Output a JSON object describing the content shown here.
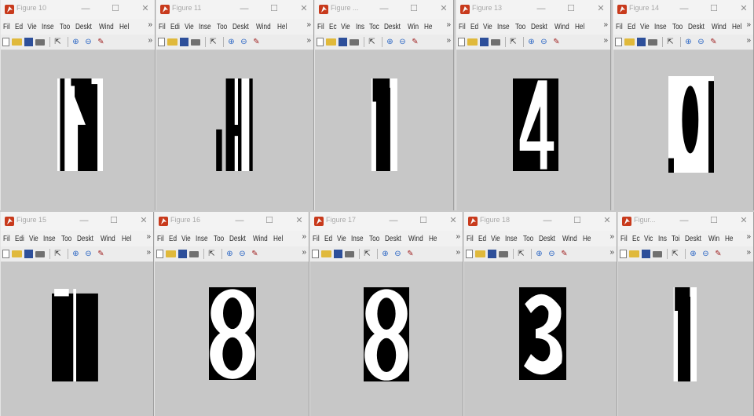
{
  "windows": [
    {
      "title": "Figure 10",
      "menus": [
        "Fil",
        "Ed",
        "Vie",
        "Inse",
        "Too",
        "Deskt",
        "Wind",
        "Hel"
      ],
      "glyph": "M"
    },
    {
      "title": "Figure 11",
      "menus": [
        "Fil",
        "Edi",
        "Vie",
        "Inse",
        "Too",
        "Deskt",
        "Wind",
        "Hel"
      ],
      "glyph": "H"
    },
    {
      "title": "Figure ...",
      "menus": [
        "Fil",
        "Ec",
        "Vie",
        "Ins",
        "Toc",
        "Deskt",
        "Win",
        "He"
      ],
      "glyph": "1"
    },
    {
      "title": "Figure 13",
      "menus": [
        "Fil",
        "Ed",
        "Vie",
        "Inse",
        "Too",
        "Deskt",
        "Wind",
        "Hel"
      ],
      "glyph": "4"
    },
    {
      "title": "Figure 14",
      "menus": [
        "Fil",
        "Ed",
        "Vie",
        "Inse",
        "Too",
        "Deskt",
        "Wind",
        "Hel"
      ],
      "glyph": "0"
    },
    {
      "title": "Figure 15",
      "menus": [
        "Fil",
        "Edi",
        "Vie",
        "Inse",
        "Too",
        "Deskt",
        "Wind",
        "Hel"
      ],
      "glyph": "11"
    },
    {
      "title": "Figure 16",
      "menus": [
        "Fil",
        "Ed",
        "Vie",
        "Inse",
        "Too",
        "Deskt",
        "Wind",
        "Hel"
      ],
      "glyph": "8"
    },
    {
      "title": "Figure 17",
      "menus": [
        "Fil",
        "Ed",
        "Vie",
        "Inse",
        "Too",
        "Deskt",
        "Wind",
        "He"
      ],
      "glyph": "8"
    },
    {
      "title": "Figure 18",
      "menus": [
        "Fil",
        "Ed",
        "Vie",
        "Inse",
        "Too",
        "Deskt",
        "Wind",
        "He"
      ],
      "glyph": "3"
    },
    {
      "title": "Figur...",
      "menus": [
        "Fil",
        "Ec",
        "Vic",
        "Ins",
        "Toi",
        "Deskt",
        "Win",
        "He"
      ],
      "glyph": "1"
    }
  ],
  "window_controls": {
    "minimize": "—",
    "maximize": "☐",
    "close": "✕"
  },
  "more_indicator": "»",
  "icons": [
    "new-figure-icon",
    "open-file-icon",
    "save-icon",
    "print-icon",
    "pointer-icon",
    "zoom-in-icon",
    "zoom-out-icon",
    "data-brush-icon"
  ],
  "colors": {
    "canvas": "#c7c7c7",
    "glyph_fg": "#000000",
    "glyph_bg": "#ffffff",
    "titlebar": "#f3f3f3",
    "app_icon": "#c83a1c"
  }
}
